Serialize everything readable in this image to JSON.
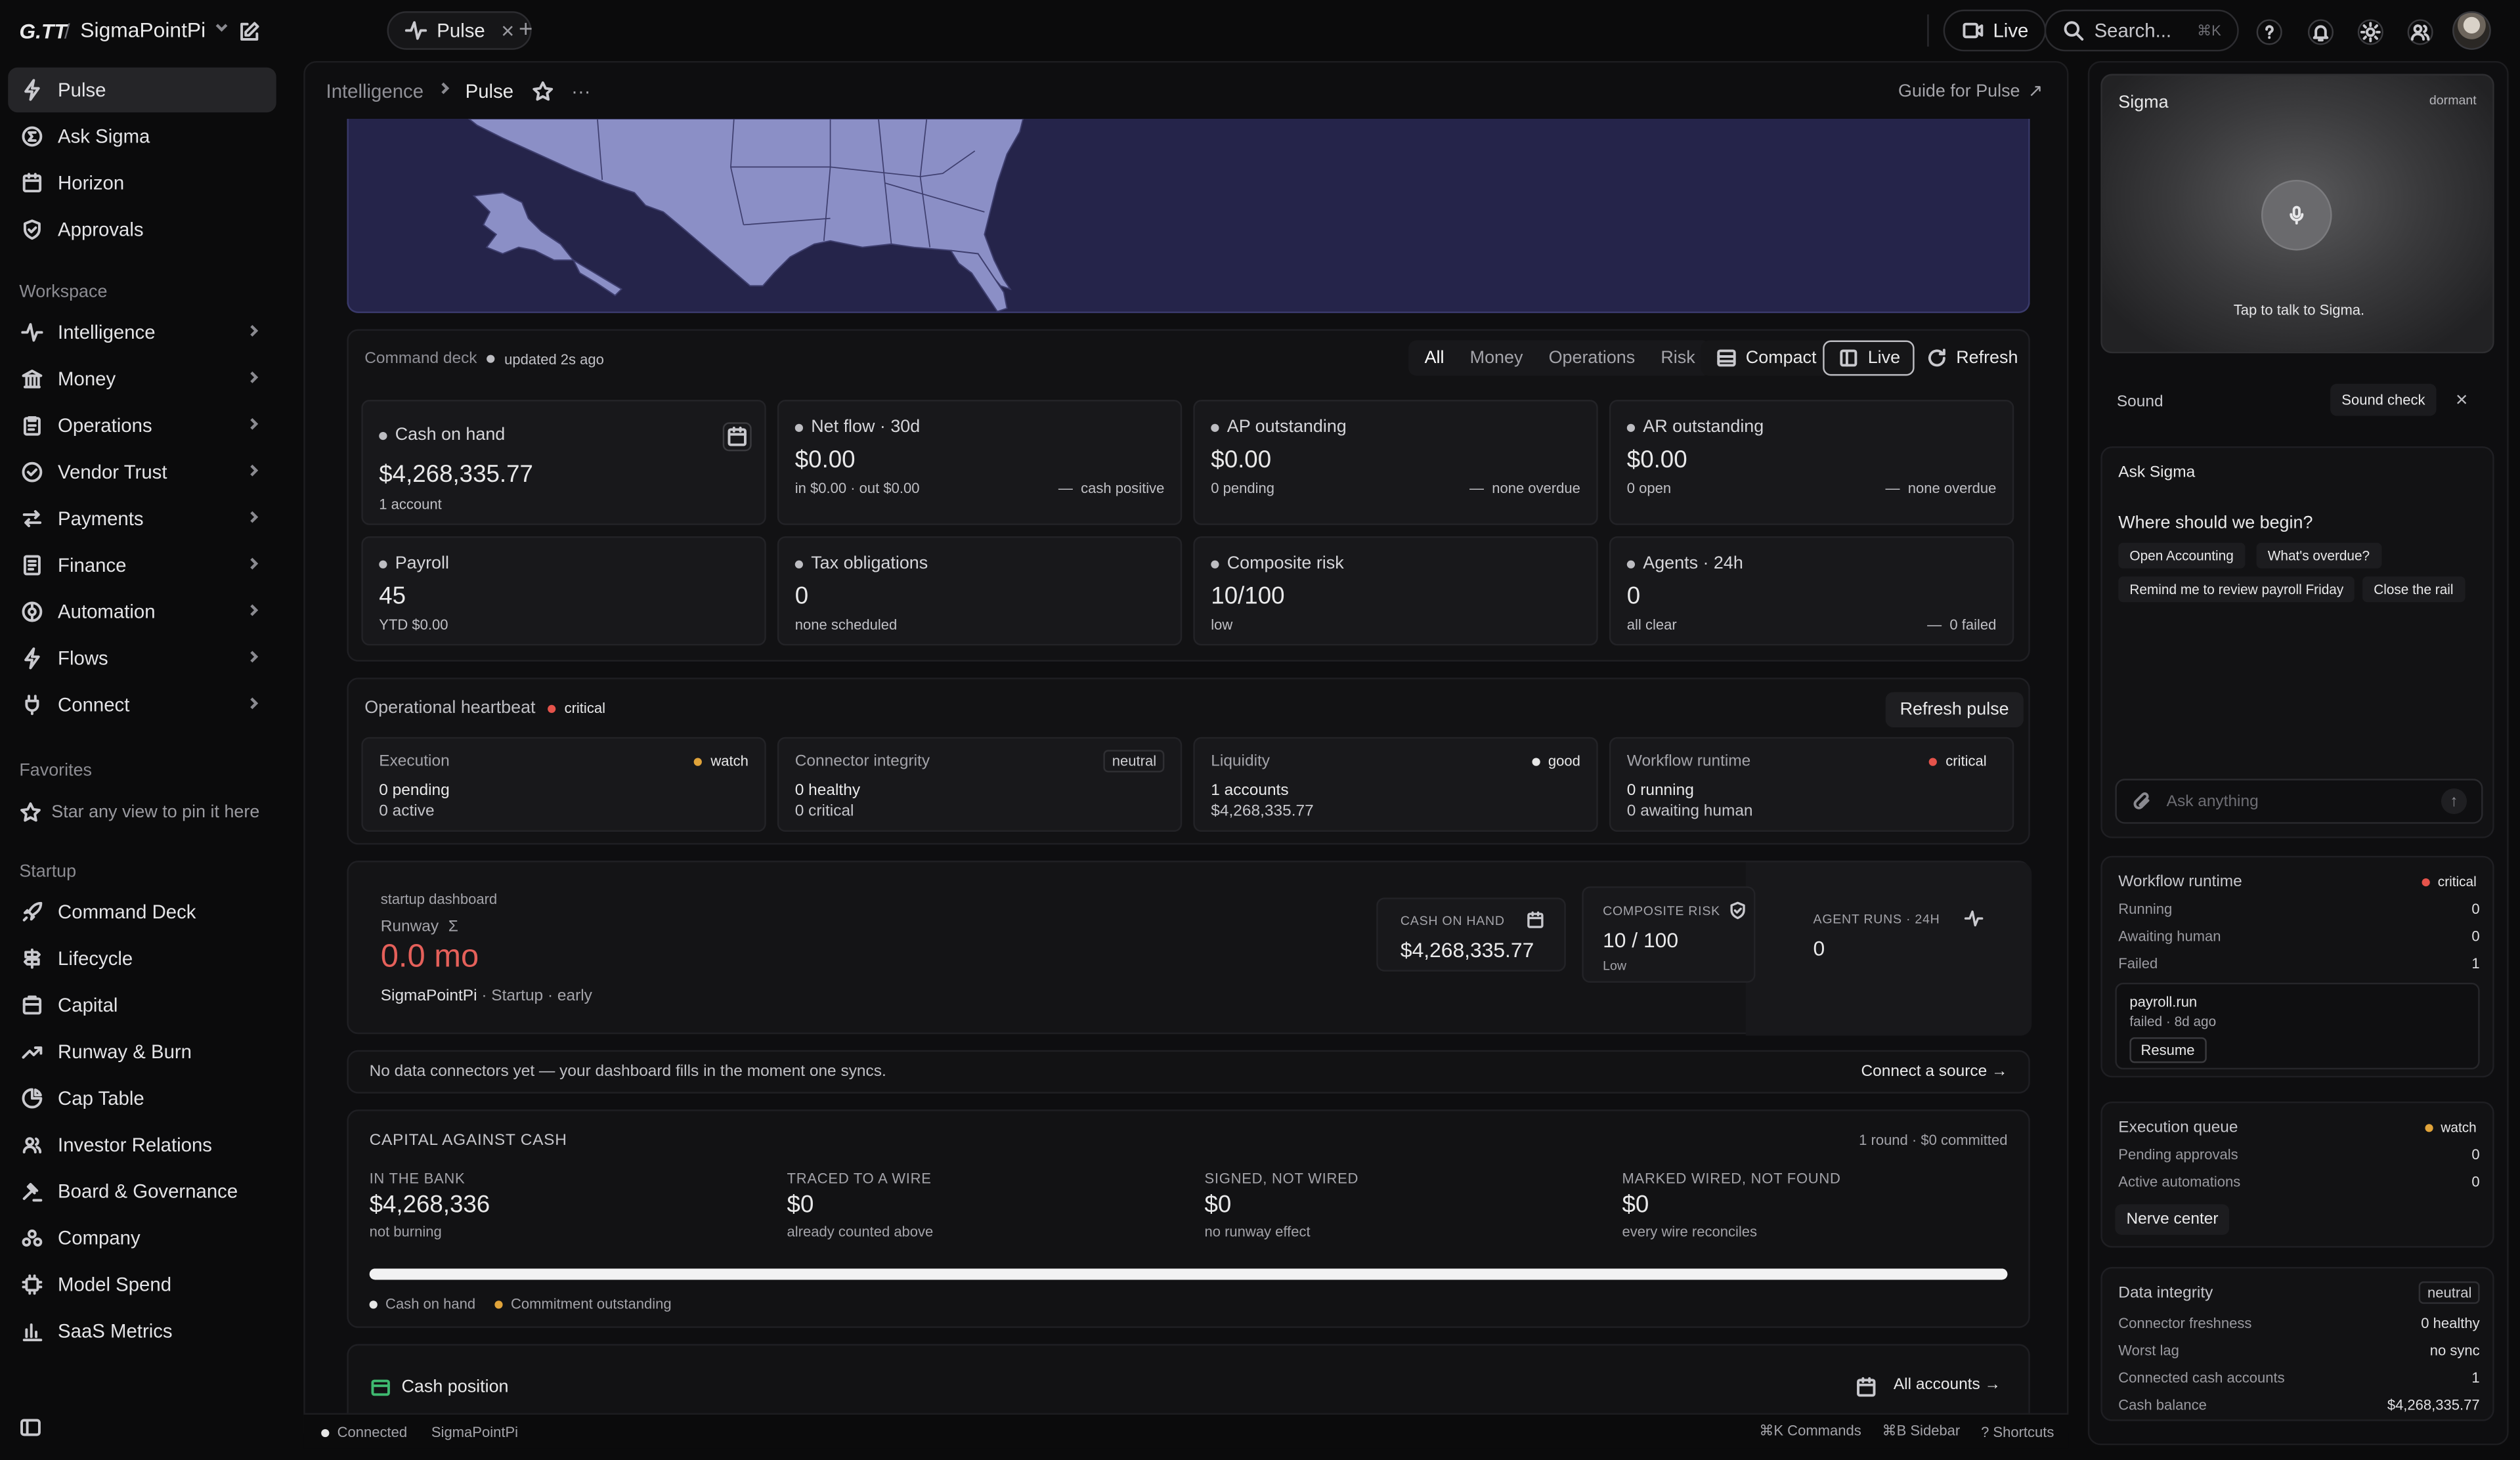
{
  "topbar": {
    "logo": "G.TT",
    "separator": "/",
    "workspace": "SigmaPointPi",
    "tab_label": "Pulse",
    "live_label": "Live",
    "search_placeholder": "Search...",
    "search_shortcut": "⌘K"
  },
  "sidebar": {
    "primary": [
      {
        "label": "Pulse"
      },
      {
        "label": "Ask Sigma"
      },
      {
        "label": "Horizon"
      },
      {
        "label": "Approvals"
      }
    ],
    "workspace_title": "Workspace",
    "workspace": [
      {
        "label": "Intelligence"
      },
      {
        "label": "Money"
      },
      {
        "label": "Operations"
      },
      {
        "label": "Vendor Trust"
      },
      {
        "label": "Payments"
      },
      {
        "label": "Finance"
      },
      {
        "label": "Automation"
      },
      {
        "label": "Flows"
      },
      {
        "label": "Connect"
      }
    ],
    "favorites_title": "Favorites",
    "favorites_hint": "Star any view to pin it here",
    "startup_title": "Startup",
    "startup": [
      {
        "label": "Command Deck"
      },
      {
        "label": "Lifecycle"
      },
      {
        "label": "Capital"
      },
      {
        "label": "Runway & Burn"
      },
      {
        "label": "Cap Table"
      },
      {
        "label": "Investor Relations"
      },
      {
        "label": "Board & Governance"
      },
      {
        "label": "Company"
      },
      {
        "label": "Model Spend"
      },
      {
        "label": "SaaS Metrics"
      }
    ]
  },
  "breadcrumb": {
    "parent": "Intelligence",
    "current": "Pulse",
    "guide": "Guide for Pulse"
  },
  "command_deck": {
    "title": "Command deck",
    "updated": "updated 2s ago",
    "tabs": [
      "All",
      "Money",
      "Operations",
      "Risk"
    ],
    "compact": "Compact",
    "live": "Live",
    "refresh": "Refresh",
    "tiles": [
      {
        "label": "Cash on hand",
        "value": "$4,268,335.77",
        "sub": "1 account",
        "note": ""
      },
      {
        "label": "Net flow · 30d",
        "value": "$0.00",
        "sub": "in $0.00 · out $0.00",
        "note": "cash positive"
      },
      {
        "label": "AP outstanding",
        "value": "$0.00",
        "sub": "0 pending",
        "note": "none overdue"
      },
      {
        "label": "AR outstanding",
        "value": "$0.00",
        "sub": "0 open",
        "note": "none overdue"
      },
      {
        "label": "Payroll",
        "value": "45",
        "sub": "YTD $0.00",
        "note": ""
      },
      {
        "label": "Tax obligations",
        "value": "0",
        "sub": "none scheduled",
        "note": ""
      },
      {
        "label": "Composite risk",
        "value": "10/100",
        "sub": "low",
        "note": ""
      },
      {
        "label": "Agents · 24h",
        "value": "0",
        "sub": "all clear",
        "note": "0 failed"
      }
    ]
  },
  "heartbeat": {
    "title": "Operational heartbeat",
    "status": "critical",
    "refresh": "Refresh pulse",
    "tiles": [
      {
        "label": "Execution",
        "badge": "watch",
        "line1": "0 pending",
        "line2": "0 active"
      },
      {
        "label": "Connector integrity",
        "badge": "neutral",
        "line1": "0 healthy",
        "line2": "0 critical"
      },
      {
        "label": "Liquidity",
        "badge": "good",
        "line1": "1 accounts",
        "line2": "$4,268,335.77"
      },
      {
        "label": "Workflow runtime",
        "badge": "critical",
        "line1": "0 running",
        "line2": "0 awaiting human"
      }
    ]
  },
  "startup_dash": {
    "kicker": "startup dashboard",
    "runway_label": "Runway",
    "runway_value": "0.0 mo",
    "company": "SigmaPointPi",
    "meta": "· Startup · early",
    "cash_label": "CASH ON HAND",
    "cash_value": "$4,268,335.77",
    "risk_label": "COMPOSITE RISK",
    "risk_value": "10 / 100",
    "risk_sub": "Low",
    "agents_label": "AGENT RUNS · 24H",
    "agents_value": "0"
  },
  "connectors": {
    "message": "No data connectors yet — your dashboard fills in the moment one syncs.",
    "action": "Connect a source →"
  },
  "capital": {
    "title": "CAPITAL AGAINST CASH",
    "summary": "1 round · $0 committed",
    "cols": [
      {
        "label": "IN THE BANK",
        "value": "$4,268,336",
        "sub": "not burning"
      },
      {
        "label": "TRACED TO A WIRE",
        "value": "$0",
        "sub": "already counted above"
      },
      {
        "label": "SIGNED, NOT WIRED",
        "value": "$0",
        "sub": "no runway effect"
      },
      {
        "label": "MARKED WIRED, NOT FOUND",
        "value": "$0",
        "sub": "every wire reconciles"
      }
    ],
    "bar_fill": 1.0,
    "legend_cash": "Cash on hand",
    "legend_commit": "Commitment outstanding"
  },
  "cash_position": {
    "title": "Cash position",
    "accounts": "All accounts"
  },
  "statusbar": {
    "connected": "Connected",
    "workspace": "SigmaPointPi",
    "k1": "⌘K Commands",
    "k2": "⌘B Sidebar",
    "k3": "? Shortcuts"
  },
  "rail": {
    "sigma_title": "Sigma",
    "sigma_state": "dormant",
    "sigma_hint": "Tap to talk to Sigma.",
    "sound_label": "Sound",
    "sound_check": "Sound check",
    "ask_title": "Ask Sigma",
    "ask_question": "Where should we begin?",
    "chips": [
      "Open Accounting",
      "What's overdue?",
      "Remind me to review payroll Friday",
      "Close the rail"
    ],
    "ask_placeholder": "Ask anything",
    "workflow": {
      "title": "Workflow runtime",
      "status": "critical",
      "rows": [
        {
          "k": "Running",
          "v": "0"
        },
        {
          "k": "Awaiting human",
          "v": "0"
        },
        {
          "k": "Failed",
          "v": "1"
        }
      ],
      "job_name": "payroll.run",
      "job_state": "failed · 8d ago",
      "resume": "Resume"
    },
    "exec": {
      "title": "Execution queue",
      "status": "watch",
      "rows": [
        {
          "k": "Pending approvals",
          "v": "0"
        },
        {
          "k": "Active automations",
          "v": "0"
        }
      ],
      "button": "Nerve center"
    },
    "integrity": {
      "title": "Data integrity",
      "status": "neutral",
      "rows": [
        {
          "k": "Connector freshness",
          "v": "0 healthy"
        },
        {
          "k": "Worst lag",
          "v": "no sync"
        },
        {
          "k": "Connected cash accounts",
          "v": "1"
        },
        {
          "k": "Cash balance",
          "v": "$4,268,335.77"
        }
      ]
    }
  },
  "colors": {
    "map_fill": "#8b8fc6",
    "map_bg": "#25244a",
    "critical": "#e5534b",
    "watch": "#e0a33a",
    "good": "#d9d9d9",
    "runway": "#e5605a"
  }
}
